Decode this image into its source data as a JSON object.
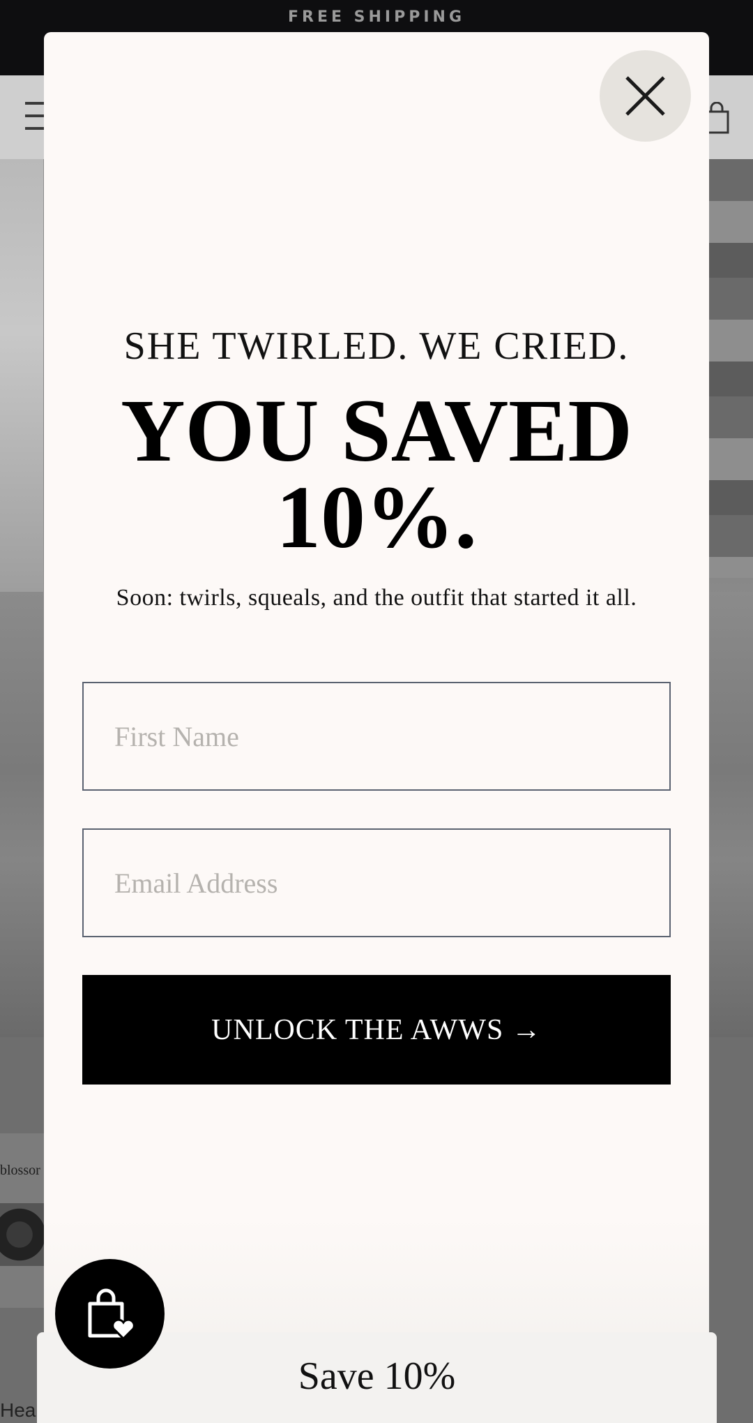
{
  "announcement": {
    "text": "FREE SHIPPING"
  },
  "header": {
    "menu_icon": "hamburger-icon",
    "cart_icon": "bag-icon"
  },
  "product": {
    "brand": "blossor",
    "title": "Hea"
  },
  "popup": {
    "close_icon": "close-icon",
    "eyebrow": "SHE TWIRLED. WE CRIED.",
    "headline_line1": "YOU SAVED",
    "headline_line2": "10%.",
    "subtext": "Soon: twirls, squeals, and the outfit that started it all.",
    "first_name_placeholder": "First Name",
    "email_placeholder": "Email Address",
    "submit_label": "UNLOCK THE AWWS →"
  },
  "save_tab": {
    "label": "Save 10%"
  },
  "wishlist": {
    "icon": "shopping-bag-heart-icon"
  },
  "colors": {
    "popup_bg": "#fdf9f7",
    "button_bg": "#000000",
    "close_bg": "#e6e3de",
    "announce_bg": "#0e0e10"
  }
}
